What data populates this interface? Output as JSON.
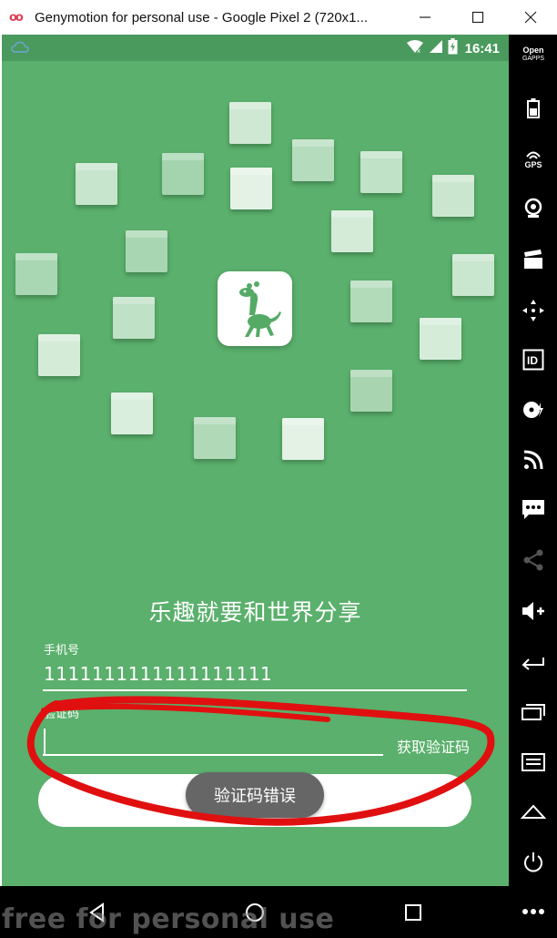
{
  "window": {
    "title": "Genymotion for personal use - Google Pixel 2 (720x1...",
    "app_icon": "oo"
  },
  "statusbar": {
    "time": "16:41",
    "icons": [
      "cloud-icon",
      "wifi-icon",
      "signal-icon",
      "battery-icon"
    ]
  },
  "app": {
    "slogan": "乐趣就要和世界分享",
    "phone_label": "手机号",
    "phone_value": "1111111111111111111",
    "code_label": "验证码",
    "code_value": "",
    "get_code_label": "获取验证码",
    "toast": "验证码错误",
    "login_button_label": ""
  },
  "sidebar": {
    "opengapps_line1": "Open",
    "opengapps_line2": "GAPPS",
    "gps_label": "GPS",
    "id_label": "ID"
  },
  "watermark": "free for personal use",
  "colors": {
    "screen_bg": "#5ab06c",
    "statusbar_bg": "#4a9a5d",
    "annotation": "#e01010",
    "toast_bg": "#666666"
  }
}
